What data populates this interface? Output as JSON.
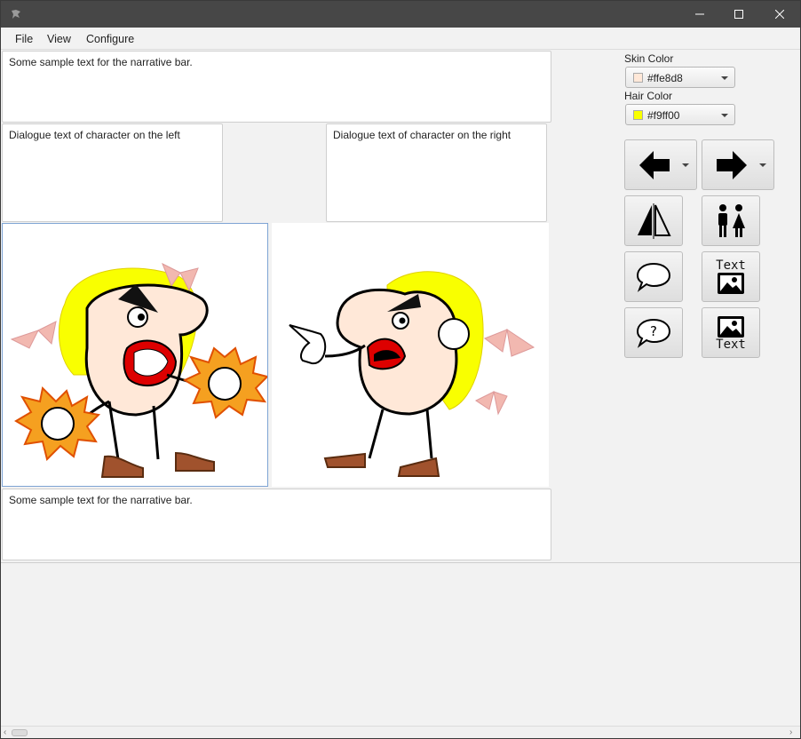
{
  "window": {
    "minimize_icon": "minimize-icon",
    "maximize_icon": "maximize-icon",
    "close_icon": "close-icon"
  },
  "menu": [
    "File",
    "View",
    "Configure"
  ],
  "narrative_top": "Some sample text for the narrative bar.",
  "dialogue_left": "Dialogue text of character on the left",
  "dialogue_right": "Dialogue text of character on the right",
  "narrative_bottom": "Some sample text for the narrative bar.",
  "controls": {
    "skin_label": "Skin Color",
    "skin_value": "#ffe8d8",
    "hair_label": "Hair Color",
    "hair_value": "#f9ff00",
    "text_icon_label": "Text"
  },
  "colors": {
    "skin": "#ffe8d8",
    "hair": "#f9ff00",
    "titlebar": "#474747"
  }
}
